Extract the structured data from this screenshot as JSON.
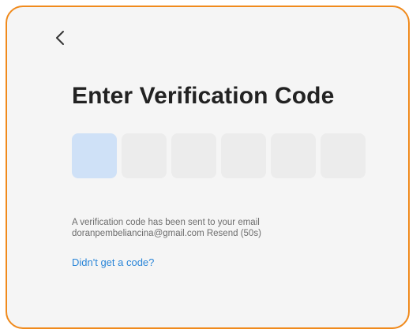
{
  "header": {
    "back_icon": "chevron-left-icon"
  },
  "main": {
    "title": "Enter Verification Code",
    "code_boxes": [
      {
        "value": "",
        "active": true
      },
      {
        "value": "",
        "active": false
      },
      {
        "value": "",
        "active": false
      },
      {
        "value": "",
        "active": false
      },
      {
        "value": "",
        "active": false
      },
      {
        "value": "",
        "active": false
      }
    ],
    "info_line1": "A verification code has been sent to your email",
    "info_email": "doranpembeliancina@gmail.com",
    "info_resend": "Resend (50s)",
    "help_link": "Didn't get a code?"
  },
  "colors": {
    "frame_border": "#f08a1c",
    "active_box": "#cfe1f7",
    "link": "#2b86d8"
  }
}
